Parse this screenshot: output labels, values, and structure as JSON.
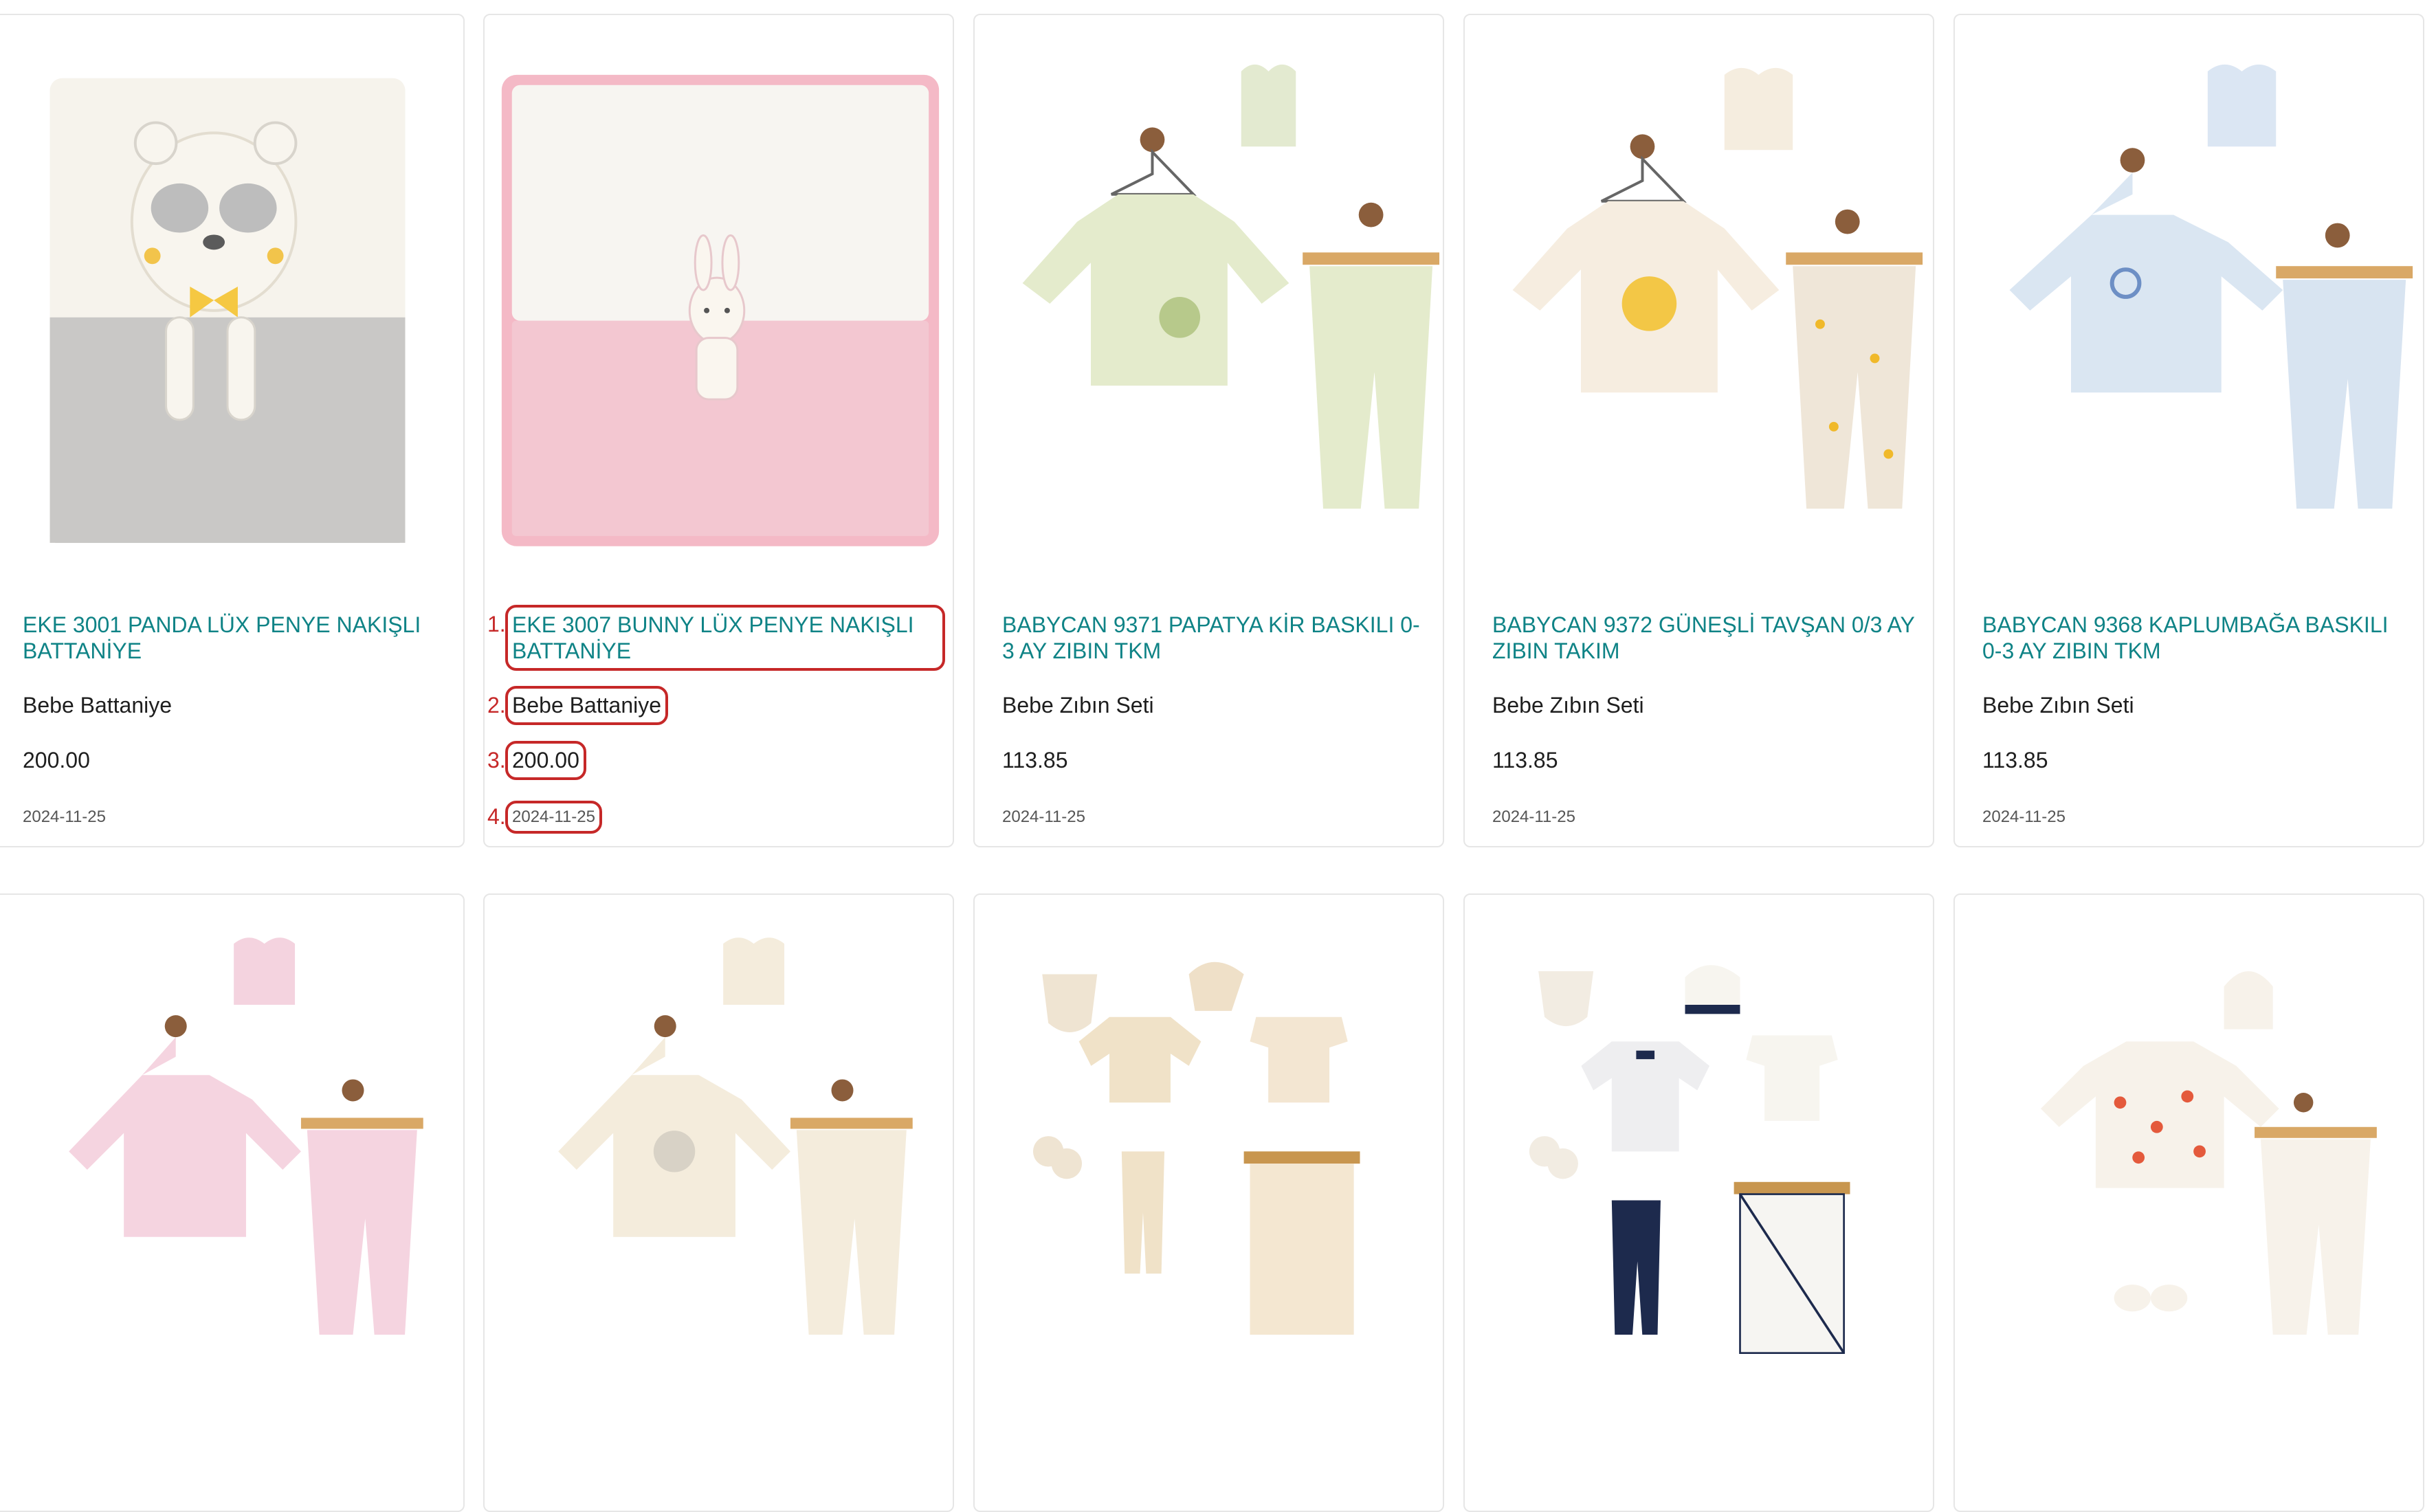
{
  "products": [
    {
      "title": "EKE 3001 PANDA LÜX PENYE NAKIŞLI BATTANİYE",
      "category": "Bebe Battaniye",
      "price": "200.00",
      "date": "2024-11-25"
    },
    {
      "title": "EKE 3007 BUNNY LÜX PENYE NAKIŞLI BATTANİYE",
      "category": "Bebe Battaniye",
      "price": "200.00",
      "date": "2024-11-25"
    },
    {
      "title": "BABYCAN 9371 PAPATYA KİR BASKILI 0-3 AY ZIBIN TKM",
      "category": "Bebe Zıbın Seti",
      "price": "113.85",
      "date": "2024-11-25"
    },
    {
      "title": "BABYCAN 9372 GÜNEŞLİ TAVŞAN 0/3 AY ZIBIN TAKIM",
      "category": "Bebe Zıbın Seti",
      "price": "113.85",
      "date": "2024-11-25"
    },
    {
      "title": "BABYCAN 9368 KAPLUMBAĞA BASKILI 0-3 AY ZIBIN TKM",
      "category": "Bebe Zıbın Seti",
      "price": "113.85",
      "date": "2024-11-25"
    }
  ],
  "annotations": [
    "1.",
    "2.",
    "3.",
    "4."
  ],
  "colors": {
    "title": "#0f8386",
    "highlight": "#c62828",
    "border": "#e6e6e6"
  }
}
